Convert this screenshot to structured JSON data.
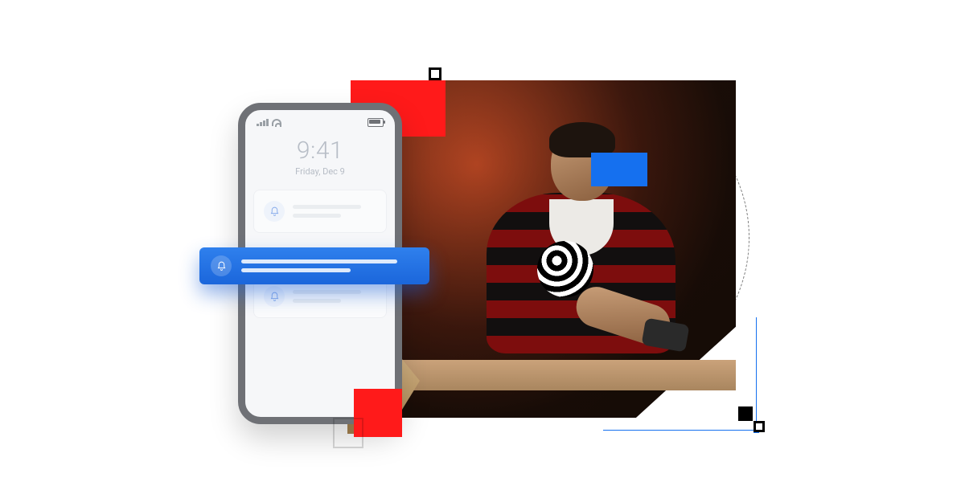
{
  "phone": {
    "time": "9:41",
    "date": "Friday, Dec 9"
  },
  "colors": {
    "accent_red": "#ff1a1a",
    "accent_blue": "#1570ef",
    "notification_blue": "#2f80ed"
  }
}
